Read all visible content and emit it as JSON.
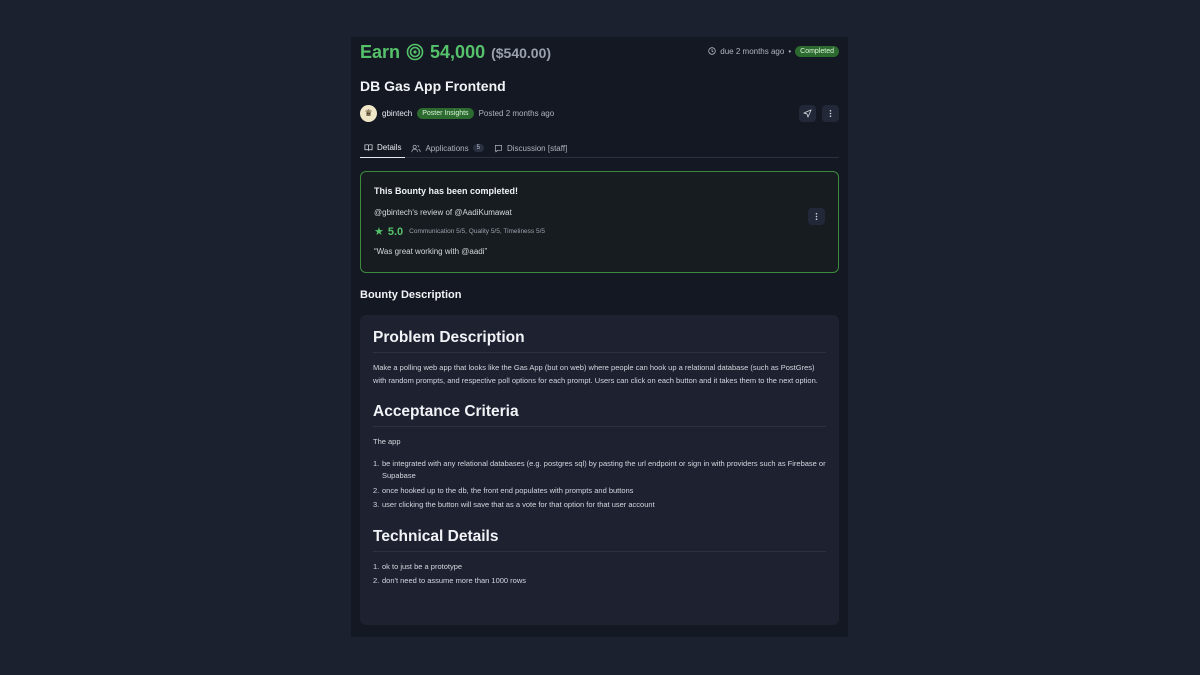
{
  "header": {
    "earn_word": "Earn",
    "amount": "54,000",
    "usd": "($540.00)",
    "due": "due 2 months ago",
    "separator": "•",
    "status": "Completed"
  },
  "title": "DB Gas App Frontend",
  "poster": {
    "name": "gbintech",
    "badge": "Poster Insights",
    "posted": "Posted 2 months ago"
  },
  "tabs": [
    {
      "label": "Details",
      "icon": "book-icon"
    },
    {
      "label": "Applications",
      "icon": "users-icon",
      "count": "5"
    },
    {
      "label": "Discussion [staff]",
      "icon": "chat-icon"
    }
  ],
  "completed": {
    "title": "This Bounty has been completed!",
    "review_line": "@gbintech's review of @AadiKumawat",
    "rating": "5.0",
    "rating_details": "Communication 5/5, Quality 5/5, Timeliness 5/5",
    "quote": "“Was great working with @aadi”"
  },
  "bounty_description": {
    "heading": "Bounty Description",
    "problem_title": "Problem Description",
    "problem_text": "Make a polling web app that looks like the Gas App (but on web) where people can hook up a relational database (such as PostGres) with random prompts, and respective poll options for each prompt. Users can click on each button and it takes them to the next option.",
    "acceptance_title": "Acceptance Criteria",
    "acceptance_intro": "The app",
    "acceptance_items": [
      "be integrated with any relational databases (e.g. postgres sql) by pasting the url endpoint or sign in with providers such as Firebase or Supabase",
      "once hooked up to the db, the front end populates with prompts and buttons",
      "user clicking the button will save that as a vote for that option for that user account"
    ],
    "technical_title": "Technical Details",
    "technical_items": [
      "ok to just be a prototype",
      "don't need to assume more than 1000 rows"
    ]
  },
  "colors": {
    "accent_green": "#55c26b",
    "badge_green": "#2d6a2f",
    "background": "#1c2130",
    "panel": "#141822"
  }
}
